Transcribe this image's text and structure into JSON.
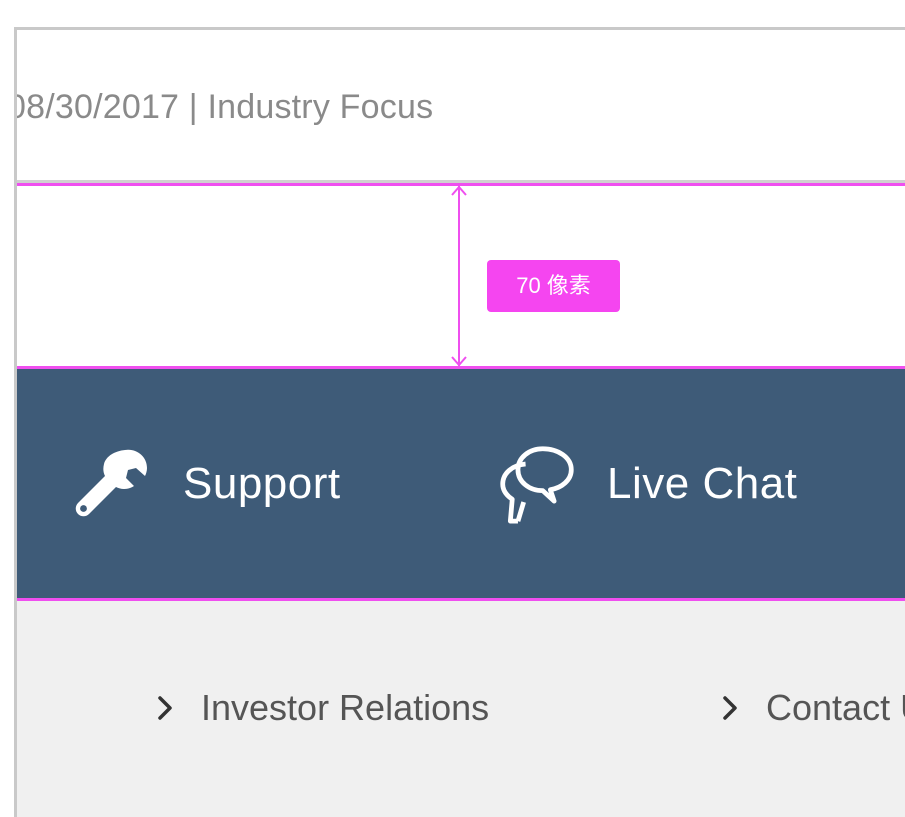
{
  "meta": {
    "text": "08/30/2017 | Industry Focus"
  },
  "measure": {
    "badge_label": "70 像素"
  },
  "actions": {
    "support": {
      "label": "Support",
      "icon": "wrench-icon"
    },
    "live_chat": {
      "label": "Live Chat",
      "icon": "chat-bubbles-icon"
    }
  },
  "footer": {
    "links": [
      {
        "label": "Investor Relations",
        "icon": "chevron-right-icon"
      },
      {
        "label": "Contact U",
        "icon": "chevron-right-icon"
      }
    ]
  },
  "colors": {
    "action_bar": "#3e5b78",
    "guide_magenta": "#ef4fef",
    "footer_bg": "#f0f0f0"
  }
}
